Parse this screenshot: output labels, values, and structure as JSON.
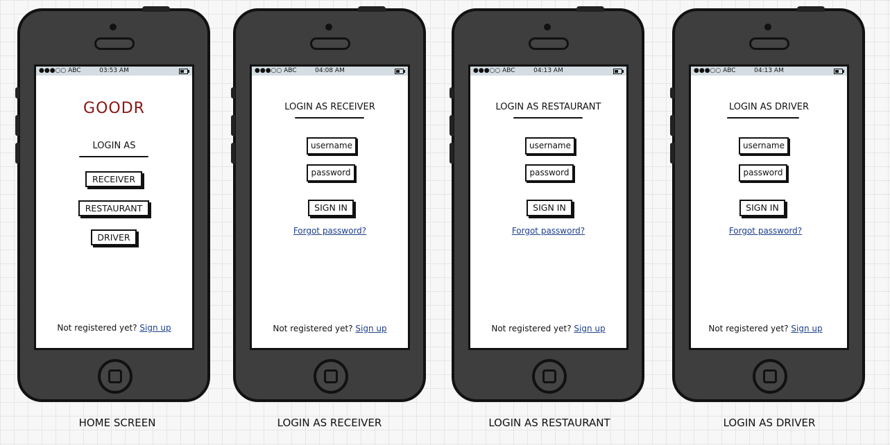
{
  "statusbar": {
    "signal": "●●●○○ ABC"
  },
  "screens": [
    {
      "time": "03:53 AM",
      "brand": "GOODR",
      "heading": "LOGIN AS",
      "buttons": [
        "RECEIVER",
        "RESTAURANT",
        "DRIVER"
      ],
      "footer_text": "Not registered yet?",
      "footer_link": "Sign up",
      "caption": "HOME SCREEN"
    },
    {
      "time": "04:08 AM",
      "heading": "LOGIN AS RECEIVER",
      "username_placeholder": "username",
      "password_placeholder": "password",
      "signin": "SIGN IN",
      "forgot": "Forgot password?",
      "footer_text": "Not registered yet?",
      "footer_link": "Sign up",
      "caption": "LOGIN AS RECEIVER"
    },
    {
      "time": "04:13 AM",
      "heading": "LOGIN AS RESTAURANT",
      "username_placeholder": "username",
      "password_placeholder": "password",
      "signin": "SIGN IN",
      "forgot": "Forgot password?",
      "footer_text": "Not registered yet?",
      "footer_link": "Sign up",
      "caption": "LOGIN AS RESTAURANT"
    },
    {
      "time": "04:13 AM",
      "heading": "LOGIN AS DRIVER",
      "username_placeholder": "username",
      "password_placeholder": "password",
      "signin": "SIGN IN",
      "forgot": "Forgot password?",
      "footer_text": "Not registered yet?",
      "footer_link": "Sign up",
      "caption": "LOGIN AS DRIVER"
    }
  ],
  "colors": {
    "brand": "#8c1414",
    "link": "#1d3f8a",
    "phone_body": "#3e3e3e",
    "statusbar": "#d4dde2"
  }
}
